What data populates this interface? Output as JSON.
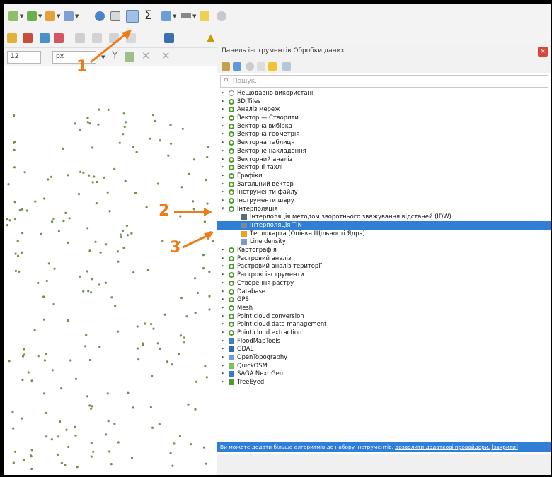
{
  "panel": {
    "title": "Панель інструментів Обробки даних",
    "close": "×",
    "search_placeholder": "Пошук...",
    "groups": [
      {
        "label": "Нещодавно використані",
        "icon": "clock-icon"
      },
      {
        "label": "3D Tiles",
        "icon": "qgis-icon"
      },
      {
        "label": "Аналіз мереж",
        "icon": "qgis-icon"
      },
      {
        "label": "Вектор — Створити",
        "icon": "qgis-icon"
      },
      {
        "label": "Векторна вибірка",
        "icon": "qgis-icon"
      },
      {
        "label": "Векторна геометрія",
        "icon": "qgis-icon"
      },
      {
        "label": "Векторна таблиця",
        "icon": "qgis-icon"
      },
      {
        "label": "Векторне накладення",
        "icon": "qgis-icon"
      },
      {
        "label": "Векторний аналіз",
        "icon": "qgis-icon"
      },
      {
        "label": "Векторні тахлі",
        "icon": "qgis-icon"
      },
      {
        "label": "Графіки",
        "icon": "qgis-icon"
      },
      {
        "label": "Загальний вектор",
        "icon": "qgis-icon"
      },
      {
        "label": "Інструменти файлу",
        "icon": "qgis-icon"
      },
      {
        "label": "Інструменти шару",
        "icon": "qgis-icon"
      },
      {
        "label": "Інтерполяція",
        "icon": "qgis-icon",
        "expanded": true
      }
    ],
    "interp_children": [
      {
        "label": "Інтерполяція методом зворотнього зважування відстаней (IDW)",
        "icon": "idw-icon"
      },
      {
        "label": "Інтерполяція TIN",
        "icon": "tin-icon",
        "selected": true
      },
      {
        "label": "Теплокарта (Оцінка Щільності Ядра)",
        "icon": "heatmap-icon"
      },
      {
        "label": "Line density",
        "icon": "line-density-icon"
      }
    ],
    "groups_after": [
      {
        "label": "Картографія",
        "icon": "qgis-icon"
      },
      {
        "label": "Растровий аналіз",
        "icon": "qgis-icon"
      },
      {
        "label": "Растровий аналіз території",
        "icon": "qgis-icon"
      },
      {
        "label": "Растрові інструменти",
        "icon": "qgis-icon"
      },
      {
        "label": "Створення растру",
        "icon": "qgis-icon"
      },
      {
        "label": "Database",
        "icon": "qgis-icon"
      },
      {
        "label": "GPS",
        "icon": "qgis-icon"
      },
      {
        "label": "Mesh",
        "icon": "qgis-icon"
      },
      {
        "label": "Point cloud conversion",
        "icon": "qgis-icon"
      },
      {
        "label": "Point cloud data management",
        "icon": "qgis-icon"
      },
      {
        "label": "Point cloud extraction",
        "icon": "qgis-icon"
      },
      {
        "label": "FloodMapTools",
        "icon": "flood-icon"
      },
      {
        "label": "GDAL",
        "icon": "gdal-icon"
      },
      {
        "label": "OpenTopography",
        "icon": "opentopo-icon"
      },
      {
        "label": "QuickOSM",
        "icon": "quickosm-icon"
      },
      {
        "label": "SAGA Next Gen",
        "icon": "saga-icon"
      },
      {
        "label": "TreeEyed",
        "icon": "tree-icon"
      }
    ],
    "footer_text": "Ви можете додати більше алгоритмів до набору інструментів,",
    "footer_link": "дозволити додаткові провайдери.",
    "footer_close": "[закрити]"
  },
  "toolbar": {
    "font_size_value": "12",
    "unit_value": "px"
  },
  "annotations": {
    "one": "1",
    "two": "2",
    "three": "3"
  },
  "colors": {
    "accent": "#2f7fd7",
    "annotation": "#ef7b16",
    "point_fill": "#6f8f4a"
  }
}
